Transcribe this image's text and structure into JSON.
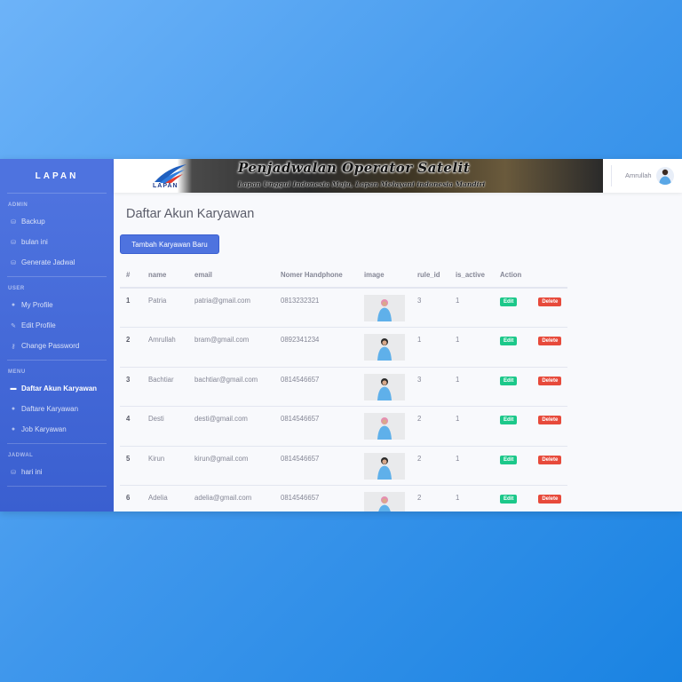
{
  "sidebar": {
    "brand": "LAPAN",
    "sections": [
      {
        "heading": "ADMIN",
        "items": [
          {
            "label": "Backup",
            "icon": "database-icon"
          },
          {
            "label": "bulan ini",
            "icon": "database-icon"
          },
          {
            "label": "Generate Jadwal",
            "icon": "database-icon"
          }
        ]
      },
      {
        "heading": "USER",
        "items": [
          {
            "label": "My Profile",
            "icon": "user-icon"
          },
          {
            "label": "Edit Profile",
            "icon": "user-edit-icon"
          },
          {
            "label": "Change Password",
            "icon": "key-icon"
          }
        ]
      },
      {
        "heading": "MENU",
        "items": [
          {
            "label": "Daftar Akun Karyawan",
            "icon": "folder-icon",
            "active": true
          },
          {
            "label": "Daftare Karyawan",
            "icon": "user-icon"
          },
          {
            "label": "Job Karyawan",
            "icon": "user-icon"
          }
        ]
      },
      {
        "heading": "JADWAL",
        "items": [
          {
            "label": "hari ini",
            "icon": "database-icon"
          }
        ]
      }
    ]
  },
  "banner": {
    "logo_text": "LAPAN",
    "title": "Penjadwalan Operator Satelit",
    "subtitle": "Lapan Unggul Indonesia Maju, Lapan Melayani indonesia Mandiri"
  },
  "topbar": {
    "user_name": "Amrullah"
  },
  "main": {
    "page_title": "Daftar Akun Karyawan",
    "add_button": "Tambah Karyawan Baru",
    "table": {
      "headers": [
        "#",
        "name",
        "email",
        "Nomer Handphone",
        "image",
        "rule_id",
        "is_active",
        "Action"
      ],
      "rows": [
        {
          "no": "1",
          "name": "Patria",
          "email": "patria@gmail.com",
          "phone": "0813232321",
          "rule_id": "3",
          "is_active": "1",
          "hijab": true
        },
        {
          "no": "2",
          "name": "Amrullah",
          "email": "bram@gmail.com",
          "phone": "0892341234",
          "rule_id": "1",
          "is_active": "1",
          "hijab": false
        },
        {
          "no": "3",
          "name": "Bachtiar",
          "email": "bachtiar@gmail.com",
          "phone": "0814546657",
          "rule_id": "3",
          "is_active": "1",
          "hijab": false
        },
        {
          "no": "4",
          "name": "Desti",
          "email": "desti@gmail.com",
          "phone": "0814546657",
          "rule_id": "2",
          "is_active": "1",
          "hijab": true
        },
        {
          "no": "5",
          "name": "Kirun",
          "email": "kirun@gmail.com",
          "phone": "0814546657",
          "rule_id": "2",
          "is_active": "1",
          "hijab": false
        },
        {
          "no": "6",
          "name": "Adelia",
          "email": "adelia@gmail.com",
          "phone": "0814546657",
          "rule_id": "2",
          "is_active": "1",
          "hijab": true
        }
      ],
      "edit_label": "Edit",
      "delete_label": "Delete"
    }
  },
  "colors": {
    "primary": "#4e73df",
    "success": "#1cc88a",
    "danger": "#e74a3b",
    "text_muted": "#858796"
  }
}
